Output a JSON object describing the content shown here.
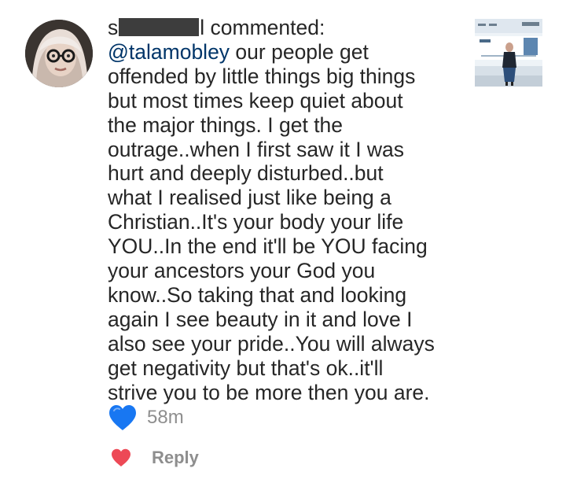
{
  "comment": {
    "username_start": "s",
    "username_end": "l",
    "action": " commented:",
    "mention": "@talamobley",
    "lines": [
      " our people get",
      "offended by little things big things",
      "but most times keep quiet about",
      "the major things. I get the",
      "outrage..when I first saw it I was",
      "hurt and deeply disturbed..but",
      "what I realised just like being a",
      "Christian..It's your body your life",
      "YOU..In the end it'll be YOU facing",
      "your ancestors your God you",
      "know..So taking that and looking",
      "again I see beauty in it and love I",
      "also see your pride..You will always",
      "get negativity but that's ok..it'll",
      "strive you to be more then you are."
    ]
  },
  "meta": {
    "time": "58m"
  },
  "actions": {
    "reply_label": "Reply"
  },
  "icons": {
    "reaction": "blue-heart-icon",
    "like": "red-heart-icon"
  },
  "colors": {
    "mention": "#003569",
    "secondary_text": "#8e8e8e",
    "blue_heart": "#1877f2",
    "red_heart": "#ed4956"
  }
}
